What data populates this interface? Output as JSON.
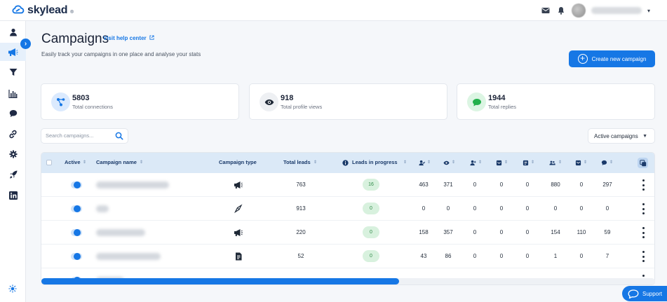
{
  "brand": {
    "name": "skylead",
    "reg": "®"
  },
  "page": {
    "title": "Campaigns",
    "help_link": "Visit help center",
    "subtitle": "Easily track your campaigns in one place and analyse your stats",
    "create_button": "Create new campaign"
  },
  "stats": [
    {
      "value": "5803",
      "label": "Total connections",
      "icon": "share-nodes-icon",
      "icon_bg": "#dbeafe",
      "icon_color": "#1677e5"
    },
    {
      "value": "918",
      "label": "Total profile views",
      "icon": "eye-icon",
      "icon_bg": "#eef0f3",
      "icon_color": "#1f2937"
    },
    {
      "value": "1944",
      "label": "Total replies",
      "icon": "chat-bubble-icon",
      "icon_bg": "#dcf5e3",
      "icon_color": "#22b04b"
    }
  ],
  "search": {
    "placeholder": "Search campaigns..."
  },
  "filter": {
    "selected": "Active campaigns"
  },
  "table": {
    "headers": {
      "active": "Active",
      "name": "Campaign name",
      "type": "Campaign type",
      "total_leads": "Total leads",
      "in_progress": "Leads in progress"
    },
    "rows": [
      {
        "type_icon": "megaphone-icon",
        "total_leads": "763",
        "in_progress": "16",
        "c1": "463",
        "c2": "371",
        "c3": "0",
        "c4": "0",
        "c5": "0",
        "c6": "880",
        "c7": "0",
        "c8": "297"
      },
      {
        "type_icon": "compass-icon",
        "total_leads": "913",
        "in_progress": "0",
        "c1": "0",
        "c2": "0",
        "c3": "0",
        "c4": "0",
        "c5": "0",
        "c6": "0",
        "c7": "0",
        "c8": "0"
      },
      {
        "type_icon": "megaphone-icon",
        "total_leads": "220",
        "in_progress": "0",
        "c1": "158",
        "c2": "357",
        "c3": "0",
        "c4": "0",
        "c5": "0",
        "c6": "154",
        "c7": "110",
        "c8": "59"
      },
      {
        "type_icon": "document-icon",
        "total_leads": "52",
        "in_progress": "0",
        "c1": "43",
        "c2": "86",
        "c3": "0",
        "c4": "0",
        "c5": "0",
        "c6": "1",
        "c7": "0",
        "c8": "7"
      }
    ]
  },
  "support": {
    "label": "Support"
  },
  "colors": {
    "accent": "#1677e5",
    "header_bg": "#dbe9f7"
  }
}
